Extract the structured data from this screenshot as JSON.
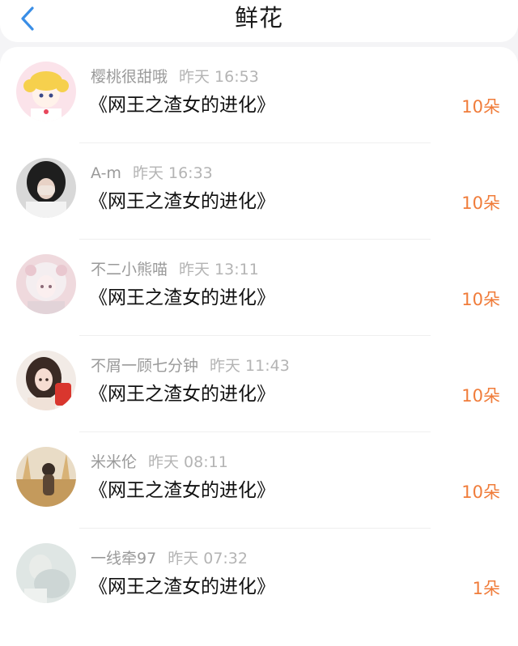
{
  "header": {
    "title": "鲜花"
  },
  "icons": {
    "back": "chevron-left-icon"
  },
  "colors": {
    "accent": "#3a8ee6",
    "count": "#f07c3a"
  },
  "records": [
    {
      "user": "樱桃很甜哦",
      "time": "昨天 16:53",
      "book": "《网王之渣女的进化》",
      "count": "10朵"
    },
    {
      "user": "A-m",
      "time": "昨天 16:33",
      "book": "《网王之渣女的进化》",
      "count": "10朵"
    },
    {
      "user": "不二小熊喵",
      "time": "昨天 13:11",
      "book": "《网王之渣女的进化》",
      "count": "10朵"
    },
    {
      "user": "不屑一顾七分钟",
      "time": "昨天 11:43",
      "book": "《网王之渣女的进化》",
      "count": "10朵"
    },
    {
      "user": "米米伦",
      "time": "昨天 08:11",
      "book": "《网王之渣女的进化》",
      "count": "10朵"
    },
    {
      "user": "一线牵97",
      "time": "昨天 07:32",
      "book": "《网王之渣女的进化》",
      "count": "1朵"
    }
  ]
}
